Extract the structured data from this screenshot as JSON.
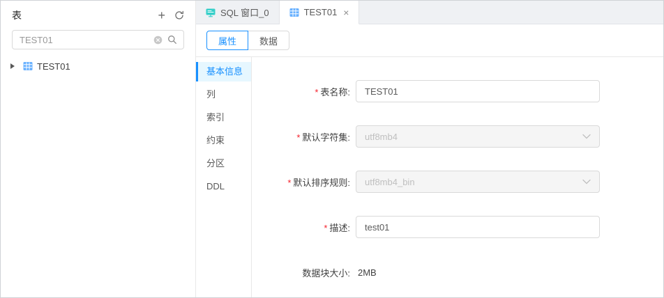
{
  "colors": {
    "primary": "#1890ff",
    "active_menu_bg": "#e6f7ff",
    "table_icon_blue": "#69b1ff",
    "sql_icon_teal": "#36cfc9",
    "required_red": "#f5222d"
  },
  "sidebar": {
    "title": "表",
    "add_icon": "+",
    "search": {
      "value": "TEST01"
    },
    "tree_items": [
      {
        "label": "TEST01"
      }
    ]
  },
  "tab_bar": {
    "tabs": [
      {
        "label": "SQL 窗口_0"
      },
      {
        "label": "TEST01",
        "close": "×"
      }
    ]
  },
  "view_tabs": {
    "properties": "属性",
    "data": "数据"
  },
  "section_menu": {
    "items": [
      {
        "label": "基本信息"
      },
      {
        "label": "列"
      },
      {
        "label": "索引"
      },
      {
        "label": "约束"
      },
      {
        "label": "分区"
      },
      {
        "label": "DDL"
      }
    ]
  },
  "form": {
    "required_mark": "*",
    "table_name": {
      "label": "表名称:",
      "value": "TEST01"
    },
    "charset": {
      "label": "默认字符集:",
      "value": "utf8mb4"
    },
    "collation": {
      "label": "默认排序规则:",
      "value": "utf8mb4_bin"
    },
    "description": {
      "label": "描述:",
      "value": "test01"
    },
    "data_block_size": {
      "label": "数据块大小:",
      "value": "2MB"
    }
  }
}
